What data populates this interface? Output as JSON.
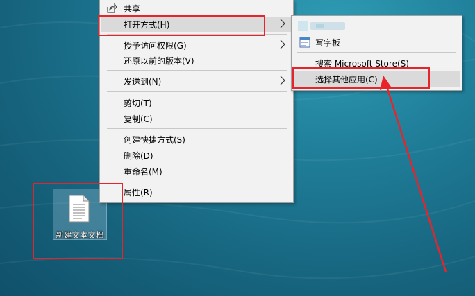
{
  "menu": {
    "share": "共享",
    "open_with": "打开方式(H)",
    "grant_access": "授予访问权限(G)",
    "restore_versions": "还原以前的版本(V)",
    "send_to": "发送到(N)",
    "cut": "剪切(T)",
    "copy": "复制(C)",
    "create_shortcut": "创建快捷方式(S)",
    "delete": "删除(D)",
    "rename": "重命名(M)",
    "properties": "属性(R)"
  },
  "submenu": {
    "wordpad": "写字板",
    "search_store": "搜索 Microsoft Store(S)",
    "choose_other_app": "选择其他应用(C)"
  },
  "desktop": {
    "file_label": "新建文本文档"
  },
  "colors": {
    "annotation": "#e8242a",
    "menu_bg": "#f2f2f2",
    "highlight": "#dadada"
  }
}
